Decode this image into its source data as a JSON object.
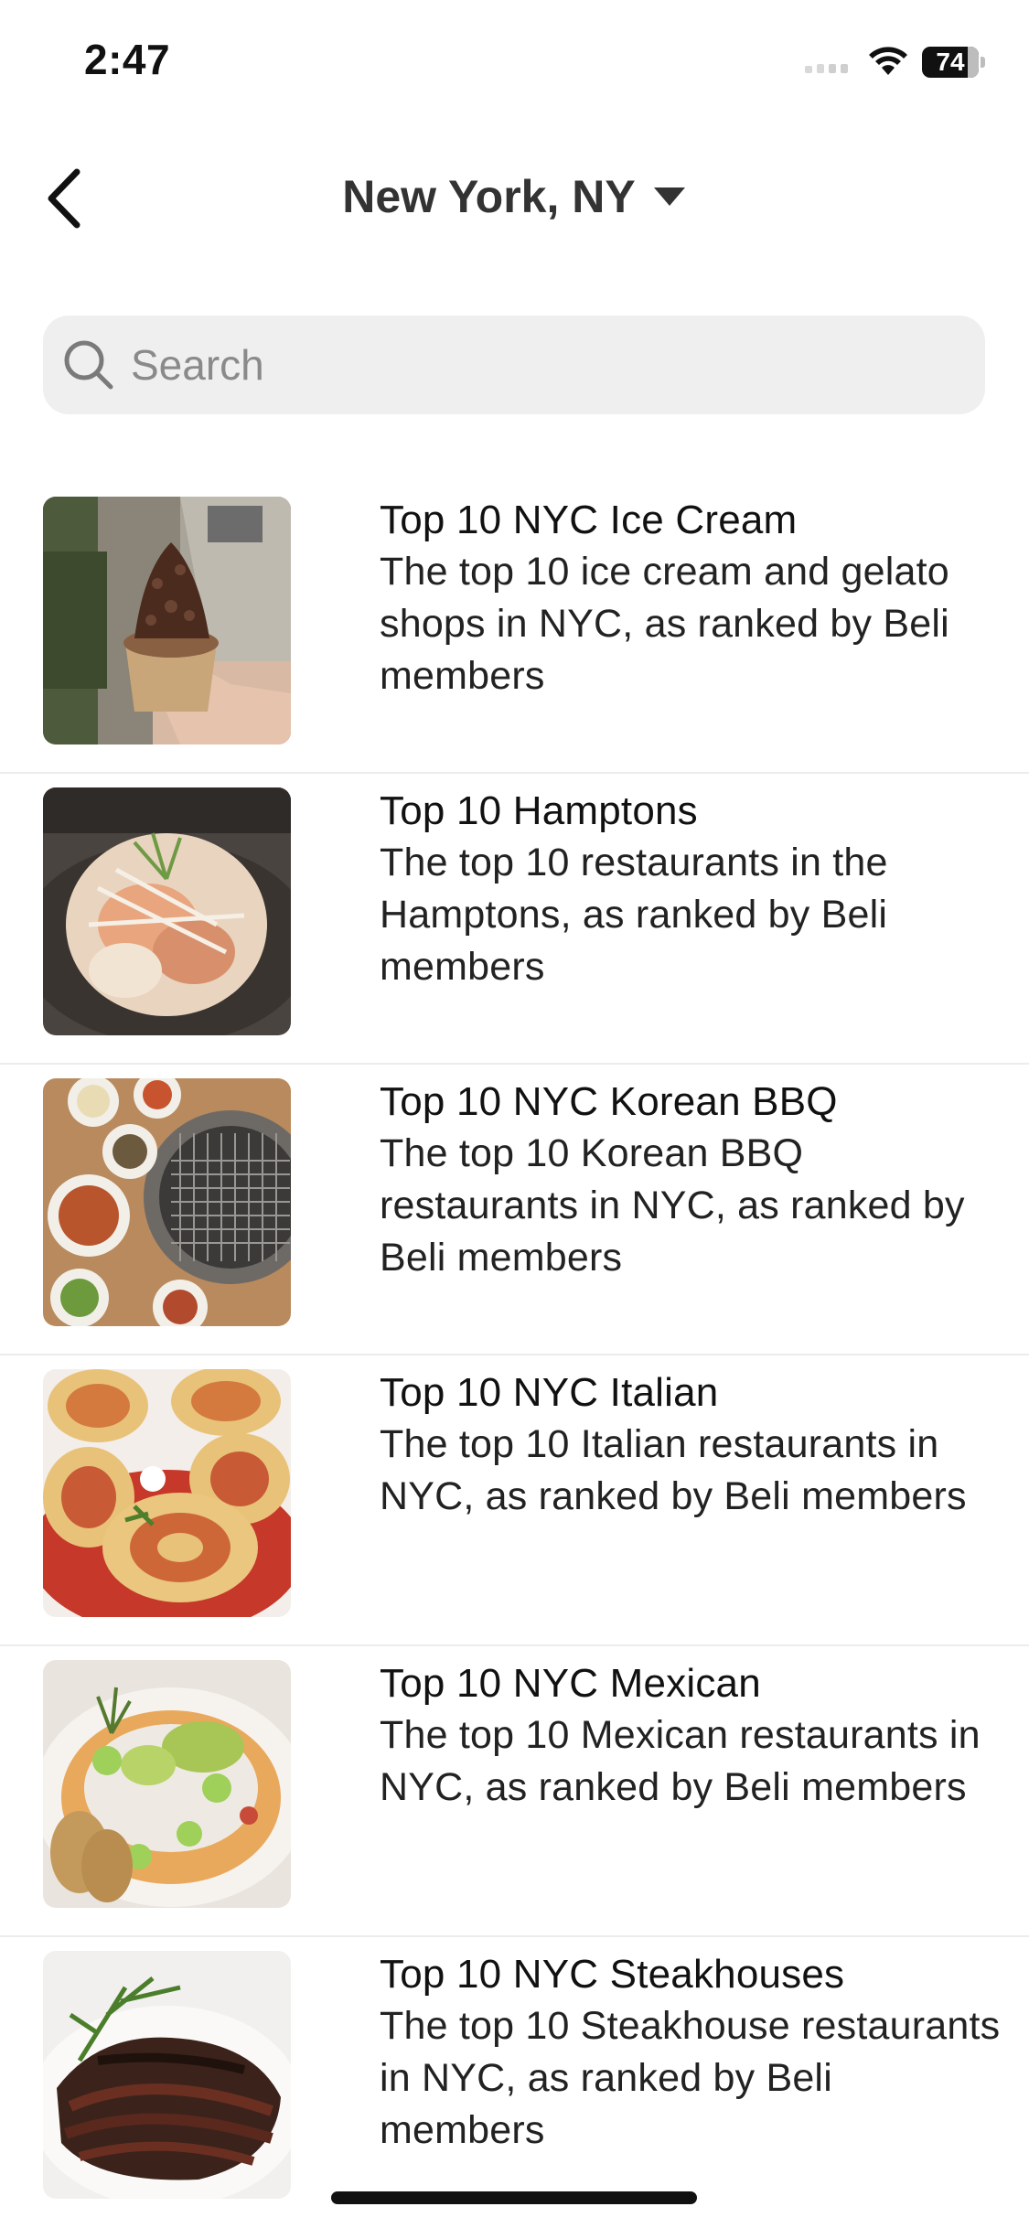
{
  "status_bar": {
    "time": "2:47",
    "battery": "74"
  },
  "header": {
    "location": "New York, NY",
    "back_icon": "chevron-left-icon",
    "dropdown_icon": "caret-down-icon"
  },
  "search": {
    "placeholder": "Search",
    "value": "",
    "icon": "search-icon"
  },
  "lists": [
    {
      "title": "Top 10 NYC Ice Cream",
      "description": "The top 10 ice cream and gelato shops in NYC, as ranked by Beli members",
      "image": "ice-cream-cone-photo"
    },
    {
      "title": "Top 10 Hamptons",
      "description": "The top 10 restaurants in the Hamptons, as ranked by Beli members",
      "image": "seafood-pasta-photo"
    },
    {
      "title": "Top 10 NYC Korean BBQ",
      "description": "The top 10 Korean BBQ restaurants in NYC, as ranked by Beli members",
      "image": "korean-bbq-grill-photo"
    },
    {
      "title": "Top 10 NYC Italian",
      "description": "The top 10 Italian restaurants in NYC, as ranked by Beli members",
      "image": "rolled-pasta-photo"
    },
    {
      "title": "Top 10 NYC Mexican",
      "description": "The top 10 Mexican restaurants in NYC, as ranked by Beli members",
      "image": "ceviche-photo"
    },
    {
      "title": "Top 10 NYC Steakhouses",
      "description": "The top 10 Steakhouse restaurants in NYC, as ranked by Beli members",
      "image": "sliced-steak-photo"
    }
  ]
}
